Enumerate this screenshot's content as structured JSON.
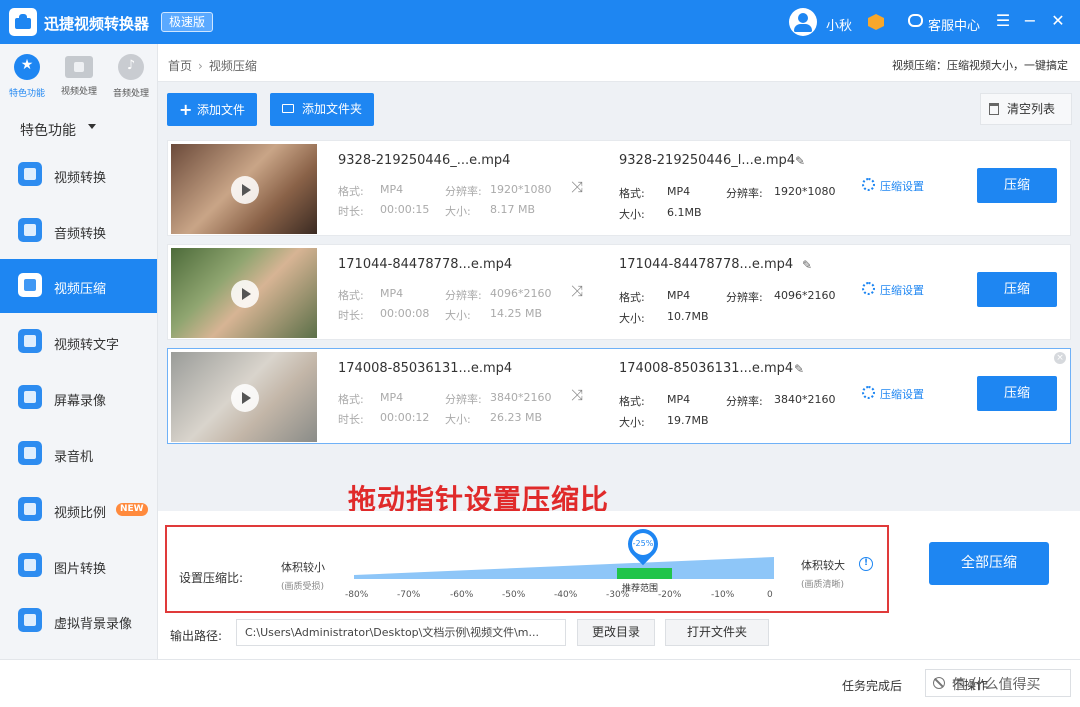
{
  "titlebar": {
    "app_title": "迅捷视频转换器",
    "edition_badge": "极速版",
    "user_name": "小秋",
    "service_label": "客服中心",
    "menu_glyph": "☰",
    "minimize_glyph": "−",
    "close_glyph": "✕"
  },
  "categories": [
    {
      "label": "特色功能",
      "icon": "star-icon",
      "active": true
    },
    {
      "label": "视频处理",
      "icon": "film-icon",
      "active": false
    },
    {
      "label": "音频处理",
      "icon": "audio-icon",
      "active": false
    }
  ],
  "section_title": "特色功能",
  "nav_items": [
    {
      "label": "视频转换",
      "icon": "video-convert-icon"
    },
    {
      "label": "音频转换",
      "icon": "audio-convert-icon"
    },
    {
      "label": "视频压缩",
      "icon": "video-compress-icon",
      "active": true
    },
    {
      "label": "视频转文字",
      "icon": "video-to-text-icon"
    },
    {
      "label": "屏幕录像",
      "icon": "screen-record-icon"
    },
    {
      "label": "录音机",
      "icon": "recorder-icon"
    },
    {
      "label": "视频比例",
      "icon": "video-ratio-icon",
      "badge": "NEW"
    },
    {
      "label": "图片转换",
      "icon": "image-convert-icon"
    },
    {
      "label": "虚拟背景录像",
      "icon": "virtual-bg-icon"
    }
  ],
  "breadcrumb": {
    "home": "首页",
    "sep": "›",
    "current": "视频压缩"
  },
  "func_desc": "视频压缩：压缩视频大小，一键搞定",
  "toolbar": {
    "add_file": "添加文件",
    "add_folder": "添加文件夹",
    "clear_list": "清空列表",
    "plus_glyph": "+"
  },
  "labels": {
    "format": "格式:",
    "resolution": "分辨率:",
    "duration": "时长:",
    "size": "大小:",
    "out_format": "格式:",
    "out_resolution": "分辨率:",
    "out_size": "大小:",
    "settings_link": "压缩设置",
    "compress_button": "压缩",
    "shuffle_glyph": "⤨",
    "edit_glyph": "✎"
  },
  "files": [
    {
      "src_name": "9328-219250446_...e.mp4",
      "format": "MP4",
      "resolution": "1920*1080",
      "duration": "00:00:15",
      "size": "8.17 MB",
      "dst_name": "9328-219250446_l...e.mp4",
      "out_format": "MP4",
      "out_resolution": "1920*1080",
      "out_size": "6.1MB"
    },
    {
      "src_name": "171044-84478778...e.mp4",
      "format": "MP4",
      "resolution": "4096*2160",
      "duration": "00:00:08",
      "size": "14.25 MB",
      "dst_name": "171044-84478778...e.mp4",
      "out_format": "MP4",
      "out_resolution": "4096*2160",
      "out_size": "10.7MB"
    },
    {
      "src_name": "174008-85036131...e.mp4",
      "format": "MP4",
      "resolution": "3840*2160",
      "duration": "00:00:12",
      "size": "26.23 MB",
      "dst_name": "174008-85036131...e.mp4",
      "out_format": "MP4",
      "out_resolution": "3840*2160",
      "out_size": "19.7MB"
    }
  ],
  "row_close_glyph": "×",
  "hint_text": "拖动指针设置压缩比",
  "compression": {
    "label": "设置压缩比:",
    "left_title": "体积较小",
    "left_sub": "(画质受损)",
    "right_title": "体积较大",
    "right_sub": "(画质清晰)",
    "info_glyph": "!",
    "pointer_value": "-25%",
    "recommended_label": "推荐范围",
    "ticks": [
      "-80%",
      "-70%",
      "-60%",
      "-50%",
      "-40%",
      "-30%",
      "-20%",
      "-10%",
      "0"
    ],
    "compress_all": "全部压缩"
  },
  "output": {
    "label": "输出路径:",
    "path": "C:\\Users\\Administrator\\Desktop\\文档示例\\视频文件\\m...",
    "change_dir": "更改目录",
    "open_folder": "打开文件夹"
  },
  "status": {
    "label": "任务完成后",
    "value": "不操作"
  },
  "watermark": "值 什么值得买",
  "colors": {
    "primary": "#1e86f2",
    "hint_red": "#e02a2a",
    "recommended_green": "#21c44a",
    "badge_orange": "#ff8a3d"
  }
}
